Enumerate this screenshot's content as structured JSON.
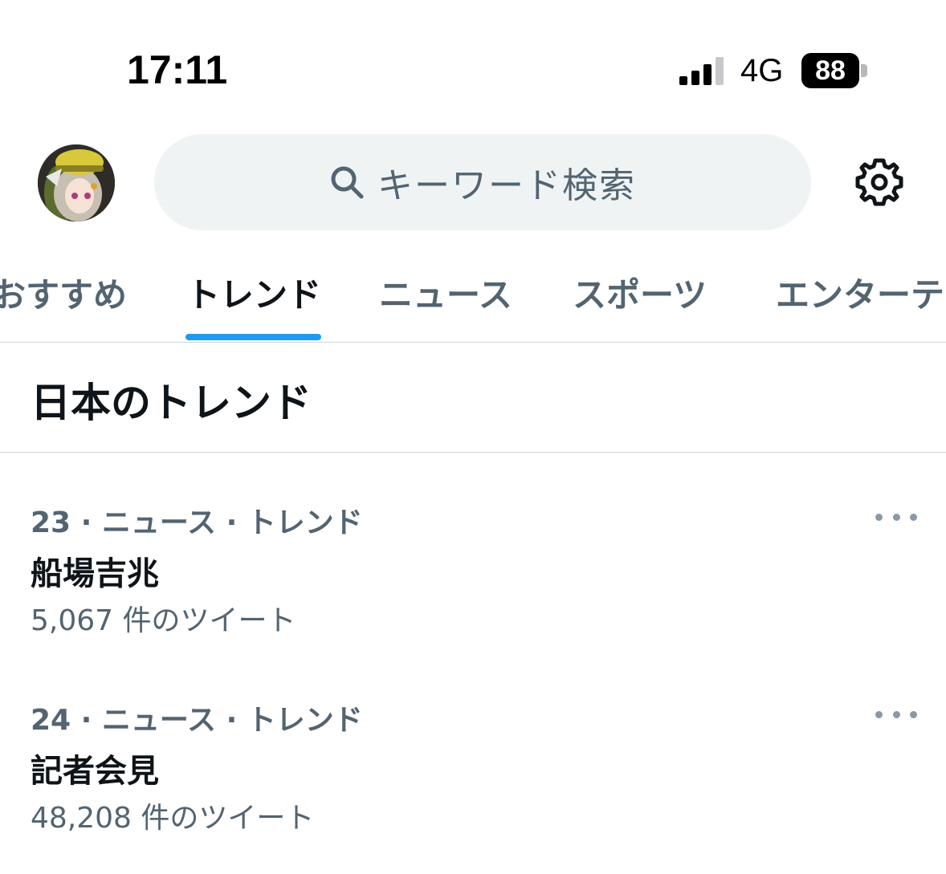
{
  "status_bar": {
    "time": "17:11",
    "network": "4G",
    "battery": "88"
  },
  "header": {
    "search_placeholder": "キーワード検索"
  },
  "tabs": [
    {
      "label": "おすすめ"
    },
    {
      "label": "トレンド"
    },
    {
      "label": "ニュース"
    },
    {
      "label": "スポーツ"
    },
    {
      "label": "エンターテ"
    }
  ],
  "section": {
    "title": "日本のトレンド"
  },
  "trends": [
    {
      "meta": "23 · ニュース · トレンド",
      "name": "船場吉兆",
      "count": "5,067 件のツイート"
    },
    {
      "meta": "24 · ニュース · トレンド",
      "name": "記者会見",
      "count": "48,208 件のツイート"
    }
  ],
  "colors": {
    "accent": "#1d9bf0",
    "primary_text": "#0f1419",
    "secondary_text": "#536471",
    "search_bg": "#eff3f4"
  }
}
